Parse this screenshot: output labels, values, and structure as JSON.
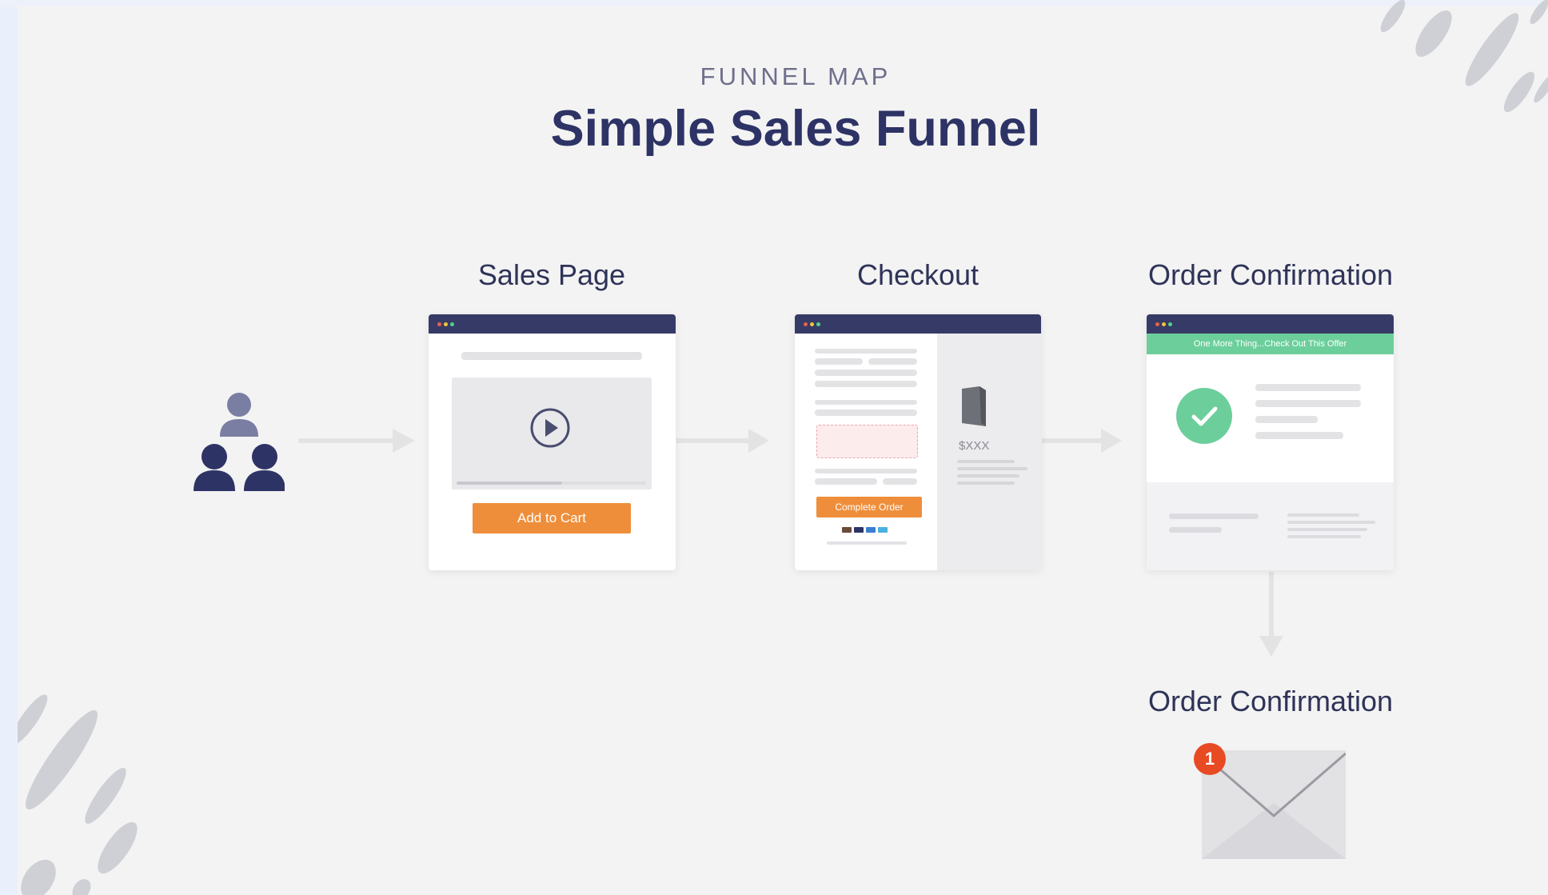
{
  "header": {
    "eyebrow": "FUNNEL MAP",
    "title": "Simple Sales Funnel"
  },
  "steps": [
    {
      "label": "Sales Page",
      "button_label": "Add to Cart"
    },
    {
      "label": "Checkout",
      "price_label": "$XXX",
      "button_label": "Complete Order"
    },
    {
      "label": "Order Confirmation",
      "banner_text": "One More Thing...Check Out This Offer"
    },
    {
      "label": "Order Confirmation",
      "badge_count": "1"
    }
  ],
  "colors": {
    "navy": "#2e3366",
    "window_bar": "#363a66",
    "cta_orange": "#ef8e3a",
    "success_green": "#6ccf9b",
    "badge_red": "#e84a24",
    "arrow_gray": "#e3e3e3"
  },
  "icons": [
    "people-icon",
    "play-icon",
    "product-box-icon",
    "checkmark-icon",
    "envelope-icon",
    "arrow-icon"
  ]
}
